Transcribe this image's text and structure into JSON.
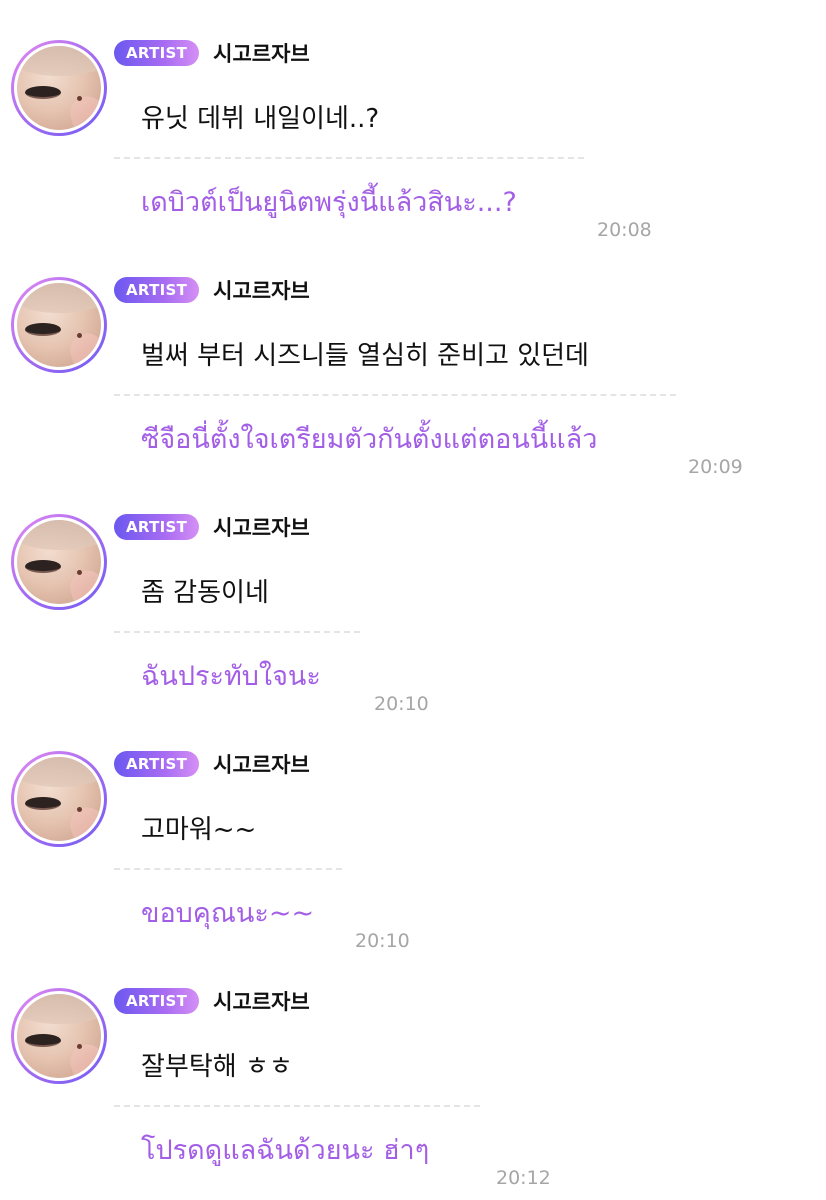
{
  "messages": [
    {
      "badge": "ARTIST",
      "author": "시고르자브",
      "avatar_icon": "artist-avatar",
      "original_text": "유닛 데뷔 내일이네..?",
      "translated_text": "เดบิวต์เป็นยูนิตพรุ่งนี้แล้วสินะ...?",
      "time": "20:08"
    },
    {
      "badge": "ARTIST",
      "author": "시고르자브",
      "avatar_icon": "artist-avatar",
      "original_text": "벌써 부터 시즈니들 열심히 준비고 있던데",
      "translated_text": "ซีจือนี่ตั้งใจเตรียมตัวกันตั้งแต่ตอนนี้แล้ว",
      "time": "20:09"
    },
    {
      "badge": "ARTIST",
      "author": "시고르자브",
      "avatar_icon": "artist-avatar",
      "original_text": "좀 감동이네",
      "translated_text": "ฉันประทับใจนะ",
      "time": "20:10"
    },
    {
      "badge": "ARTIST",
      "author": "시고르자브",
      "avatar_icon": "artist-avatar",
      "original_text": "고마워~~",
      "translated_text": "ขอบคุณนะ~~",
      "time": "20:10"
    },
    {
      "badge": "ARTIST",
      "author": "시고르자브",
      "avatar_icon": "artist-avatar",
      "original_text": "잘부탁해 ㅎㅎ",
      "translated_text": "โปรดดูแลฉันด้วยนะ ฮ่าๆ",
      "time": "20:12"
    }
  ],
  "colors": {
    "badge_gradient_start": "#6b58f0",
    "badge_gradient_end": "#d58ff4",
    "translation_text": "#a35ee6",
    "timestamp_text": "#a6a6a6",
    "original_text": "#111111"
  }
}
